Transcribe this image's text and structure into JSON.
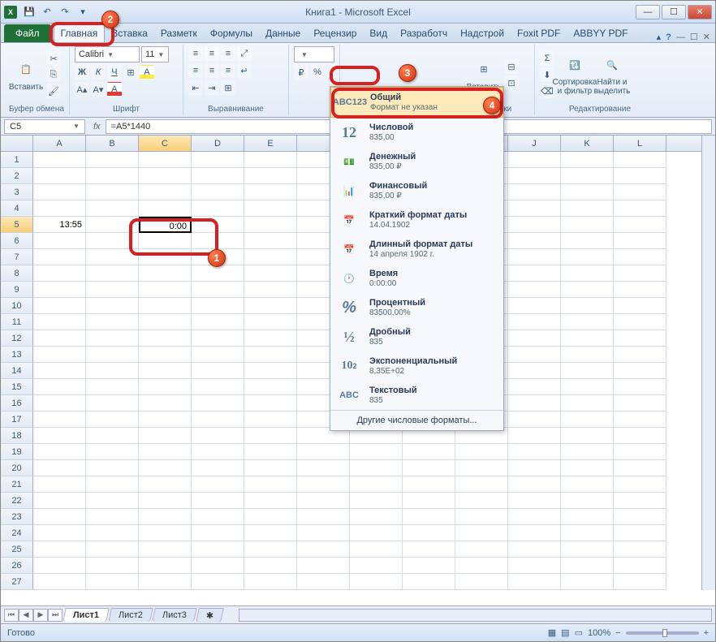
{
  "titlebar": {
    "title": "Книга1 - Microsoft Excel"
  },
  "tabs": {
    "file": "Файл",
    "list": [
      "Главная",
      "Вставка",
      "Разметк",
      "Формулы",
      "Данные",
      "Рецензир",
      "Вид",
      "Разработч",
      "Надстрой",
      "Foxit PDF",
      "ABBYY PDF"
    ]
  },
  "ribbon": {
    "clipboard": {
      "paste": "Вставить",
      "label": "Буфер обмена"
    },
    "font": {
      "name": "Calibri",
      "size": "11",
      "label": "Шрифт"
    },
    "align": {
      "label": "Выравнивание"
    },
    "cells": {
      "insert": "Вставить",
      "label": "Ячейки"
    },
    "edit": {
      "sort": "Сортировка\nи фильтр",
      "find": "Найти и\nвыделить",
      "label": "Редактирование"
    }
  },
  "formula": {
    "cellref": "C5",
    "formula": "=A5*1440"
  },
  "columns": [
    "A",
    "B",
    "C",
    "D",
    "E",
    "",
    "",
    "",
    "",
    "J",
    "K",
    "L"
  ],
  "cells": {
    "a5": "13:55",
    "c5": "0:00"
  },
  "dropdown": {
    "items": [
      {
        "ico": "ABC\n123",
        "title": "Общий",
        "sub": "Формат не указан"
      },
      {
        "ico": "12",
        "title": "Числовой",
        "sub": "835,00"
      },
      {
        "ico": "₽",
        "title": "Денежный",
        "sub": "835,00 ₽"
      },
      {
        "ico": "₽",
        "title": "Финансовый",
        "sub": "835,00 ₽"
      },
      {
        "ico": "📅",
        "title": "Краткий формат даты",
        "sub": "14.04.1902"
      },
      {
        "ico": "📅",
        "title": "Длинный формат даты",
        "sub": "14 апреля 1902 г."
      },
      {
        "ico": "🕐",
        "title": "Время",
        "sub": "0:00:00"
      },
      {
        "ico": "%",
        "title": "Процентный",
        "sub": "83500,00%"
      },
      {
        "ico": "½",
        "title": "Дробный",
        "sub": "835"
      },
      {
        "ico": "10²",
        "title": "Экспоненциальный",
        "sub": "8,35E+02"
      },
      {
        "ico": "ABC",
        "title": "Текстовый",
        "sub": "835"
      }
    ],
    "more": "Другие числовые форматы..."
  },
  "sheets": [
    "Лист1",
    "Лист2",
    "Лист3"
  ],
  "status": {
    "ready": "Готово",
    "zoom": "100%"
  }
}
